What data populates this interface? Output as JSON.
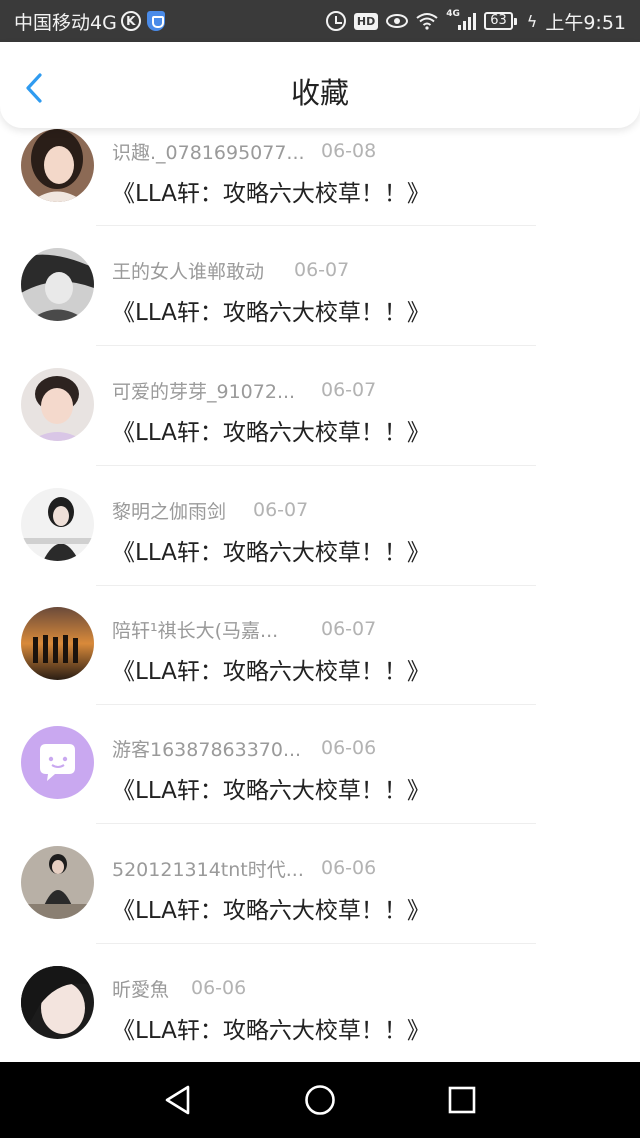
{
  "status_bar": {
    "carrier": "中国移动4G",
    "k_badge": "K",
    "hd": "HD",
    "network": "4G",
    "battery": "63",
    "time": "上午9:51"
  },
  "header": {
    "title": "收藏"
  },
  "items": [
    {
      "name": "识趣._0781695077...",
      "date": "06-08",
      "title": "《LLA轩：攻略六大校草！！》"
    },
    {
      "name": "王的女人谁郸敢动",
      "date": "06-07",
      "title": "《LLA轩：攻略六大校草！！》"
    },
    {
      "name": "可爱的芽芽_91072...",
      "date": "06-07",
      "title": "《LLA轩：攻略六大校草！！》"
    },
    {
      "name": "黎明之伽雨剑",
      "date": "06-07",
      "title": "《LLA轩：攻略六大校草！！》"
    },
    {
      "name": "陪轩¹祺长大(马嘉...",
      "date": "06-07",
      "title": "《LLA轩：攻略六大校草！！》"
    },
    {
      "name": "游客16387863370...",
      "date": "06-06",
      "title": "《LLA轩：攻略六大校草！！》"
    },
    {
      "name": "520121314tnt时代...",
      "date": "06-06",
      "title": "《LLA轩：攻略六大校草！！》"
    },
    {
      "name": "昕愛魚",
      "date": "06-06",
      "title": "《LLA轩：攻略六大校草！！》"
    }
  ],
  "colors": {
    "accent": "#2f9bf0",
    "status_bar": "#3a3a3a",
    "guest_avatar": "#c9a8f0"
  }
}
